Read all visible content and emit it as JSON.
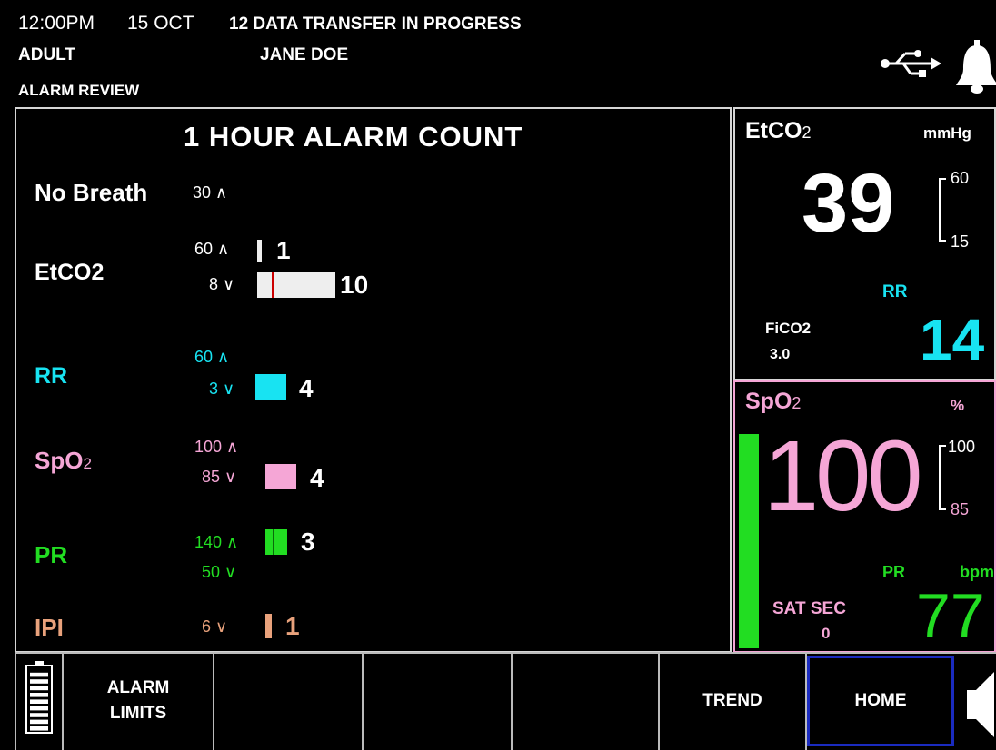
{
  "status": {
    "time": "12:00PM",
    "date": "15 OCT",
    "message": "12 DATA TRANSFER IN PROGRESS",
    "patient_type": "ADULT",
    "patient_name": "JANE DOE",
    "screen": "ALARM REVIEW"
  },
  "alarm_panel": {
    "title": "1 HOUR ALARM COUNT",
    "rows": {
      "no_breath": {
        "label": "No Breath",
        "high_limit": "30 ∧"
      },
      "etco2": {
        "label": "EtCO2",
        "high_limit": "60 ∧",
        "high_count": "1",
        "low_limit": "8 ∨",
        "low_count": "10"
      },
      "rr": {
        "label": "RR",
        "high_limit": "60 ∧",
        "low_limit": "3 ∨",
        "low_count": "4"
      },
      "spo2": {
        "label": "SpO",
        "label_sub": "2",
        "high_limit": "100 ∧",
        "low_limit": "85 ∨",
        "low_count": "4"
      },
      "pr": {
        "label": "PR",
        "high_limit": "140 ∧",
        "high_count": "3",
        "low_limit": "50 ∨"
      },
      "ipi": {
        "label": "IPI",
        "low_limit": "6 ∨",
        "low_count": "1"
      }
    }
  },
  "etco2_panel": {
    "label": "EtCO",
    "label_sub": "2",
    "unit": "mmHg",
    "value": "39",
    "limit_high": "60",
    "limit_low": "15",
    "rr_label": "RR",
    "rr_value": "14",
    "fico2_label": "FiCO2",
    "fico2_value": "3.0"
  },
  "spo2_panel": {
    "label": "SpO",
    "label_sub": "2",
    "unit": "%",
    "value": "100",
    "limit_high": "100",
    "limit_low": "85",
    "pr_label": "PR",
    "pr_unit": "bpm",
    "pr_value": "77",
    "sat_sec_label": "SAT SEC",
    "sat_sec_value": "0",
    "pleth_level": 1.0
  },
  "softkeys": {
    "alarm_limits": [
      "ALARM",
      "LIMITS"
    ],
    "trend": "TREND",
    "home": "HOME"
  },
  "battery_level": 1.0,
  "colors": {
    "cyan": "#18e3f2",
    "pink": "#f5a6d6",
    "green": "#22dd22",
    "salmon": "#e9a27c",
    "home_border": "#1a2bbf"
  },
  "icons": [
    "usb-icon",
    "bell-icon",
    "battery-icon",
    "speaker-icon"
  ]
}
